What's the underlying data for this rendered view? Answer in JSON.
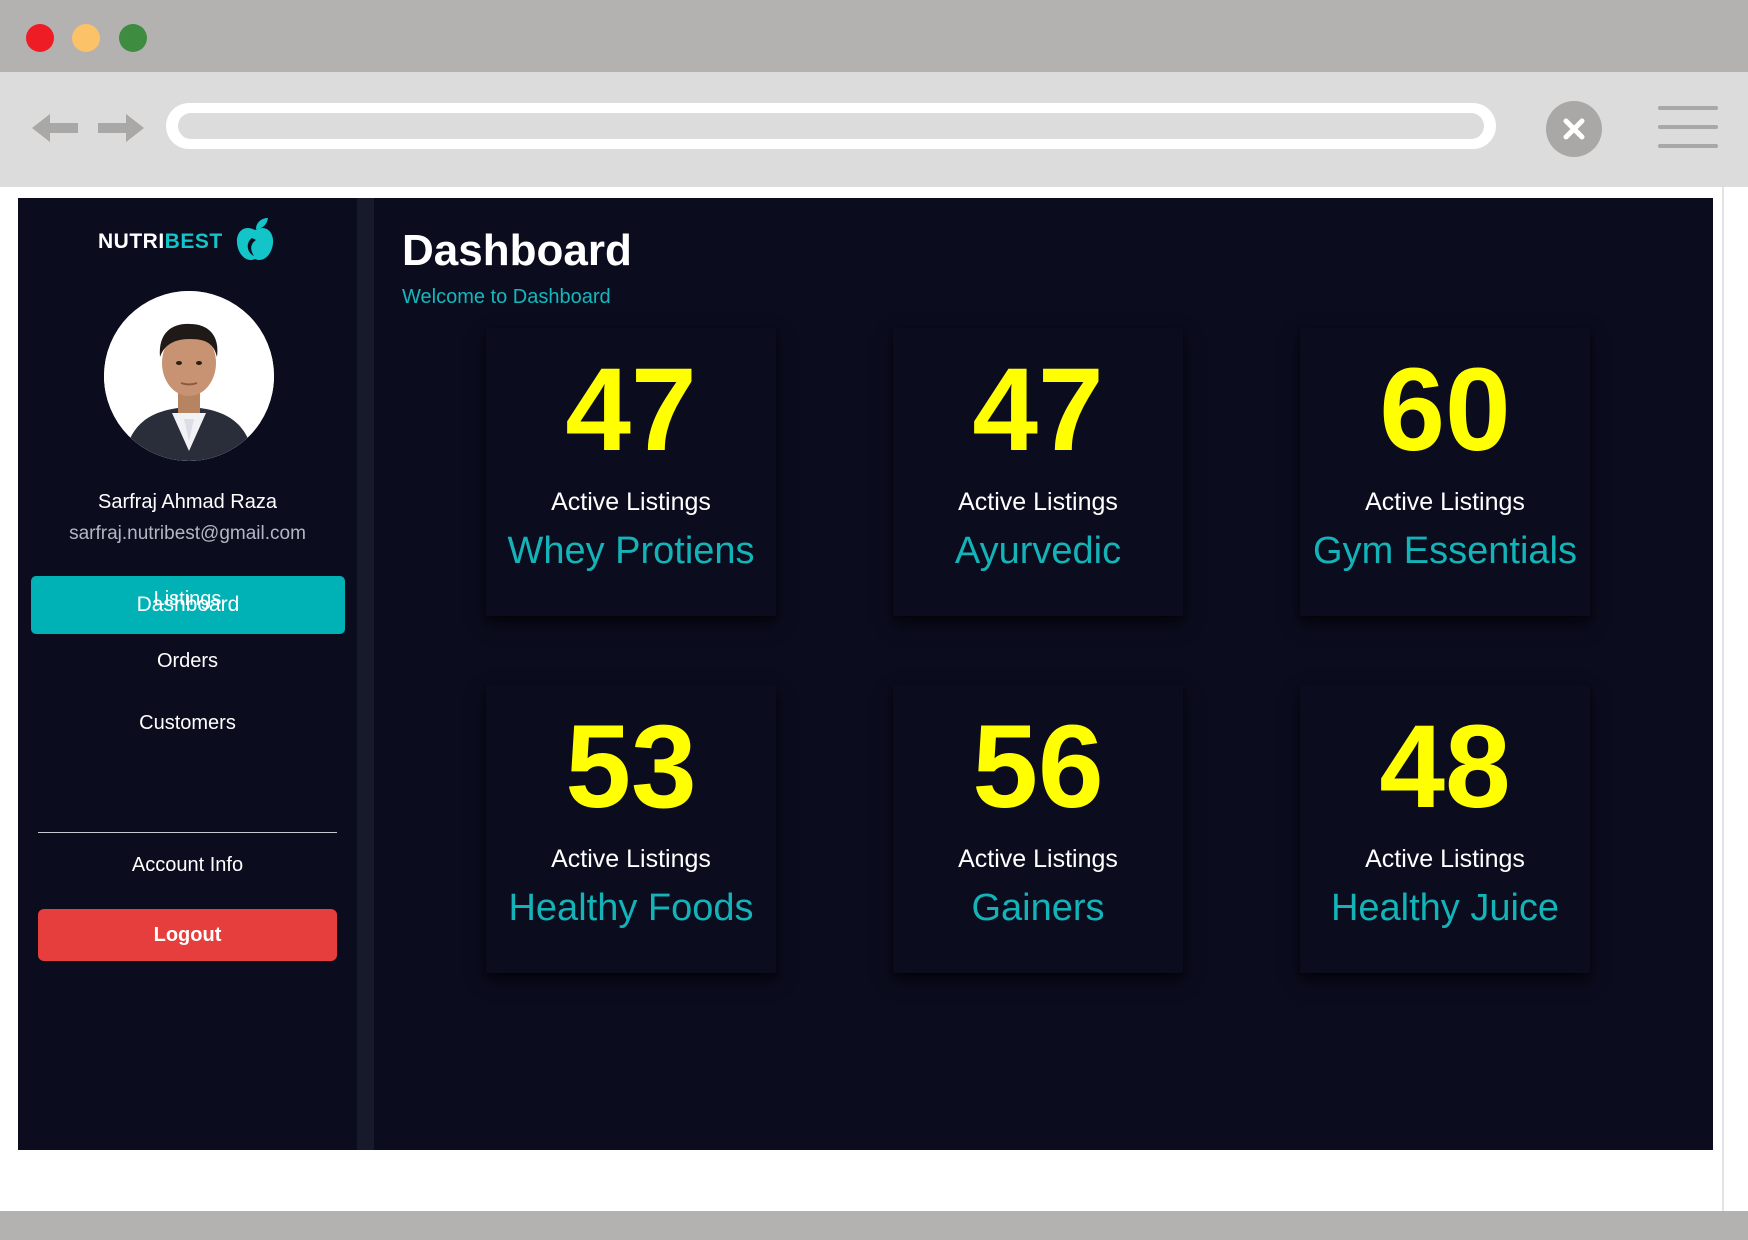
{
  "app": {
    "logo": {
      "part_a": "NUTRI",
      "part_b": "BEST"
    },
    "user": {
      "name": "Sarfraj Ahmad Raza",
      "email": "sarfraj.nutribest@gmail.com"
    },
    "sidebar": {
      "items": [
        {
          "label": "Dashboard",
          "active": true
        },
        {
          "label": "Listings"
        },
        {
          "label": "Orders"
        },
        {
          "label": "Customers"
        },
        {
          "label": "Account Info"
        }
      ],
      "logout_label": "Logout"
    },
    "main": {
      "title": "Dashboard",
      "subtitle": "Welcome to Dashboard",
      "cards": [
        {
          "count": "47",
          "label": "Active Listings",
          "category": "Whey Protiens"
        },
        {
          "count": "47",
          "label": "Active Listings",
          "category": "Ayurvedic"
        },
        {
          "count": "60",
          "label": "Active Listings",
          "category": "Gym Essentials"
        },
        {
          "count": "53",
          "label": "Active Listings",
          "category": "Healthy Foods"
        },
        {
          "count": "56",
          "label": "Active Listings",
          "category": "Gainers"
        },
        {
          "count": "48",
          "label": "Active Listings",
          "category": "Healthy Juice"
        }
      ]
    }
  },
  "colors": {
    "background": "#0b0c1e",
    "accent": "#00b2b6",
    "count": "#ffff00",
    "logout": "#e63d3d"
  },
  "icons": {
    "window_controls": [
      "close-dot",
      "minimize-dot",
      "maximize-dot"
    ],
    "browser": [
      "back-arrow-icon",
      "forward-arrow-icon",
      "close-icon",
      "menu-icon"
    ],
    "logo": "apple-leaf-icon",
    "avatar": "user-photo"
  }
}
